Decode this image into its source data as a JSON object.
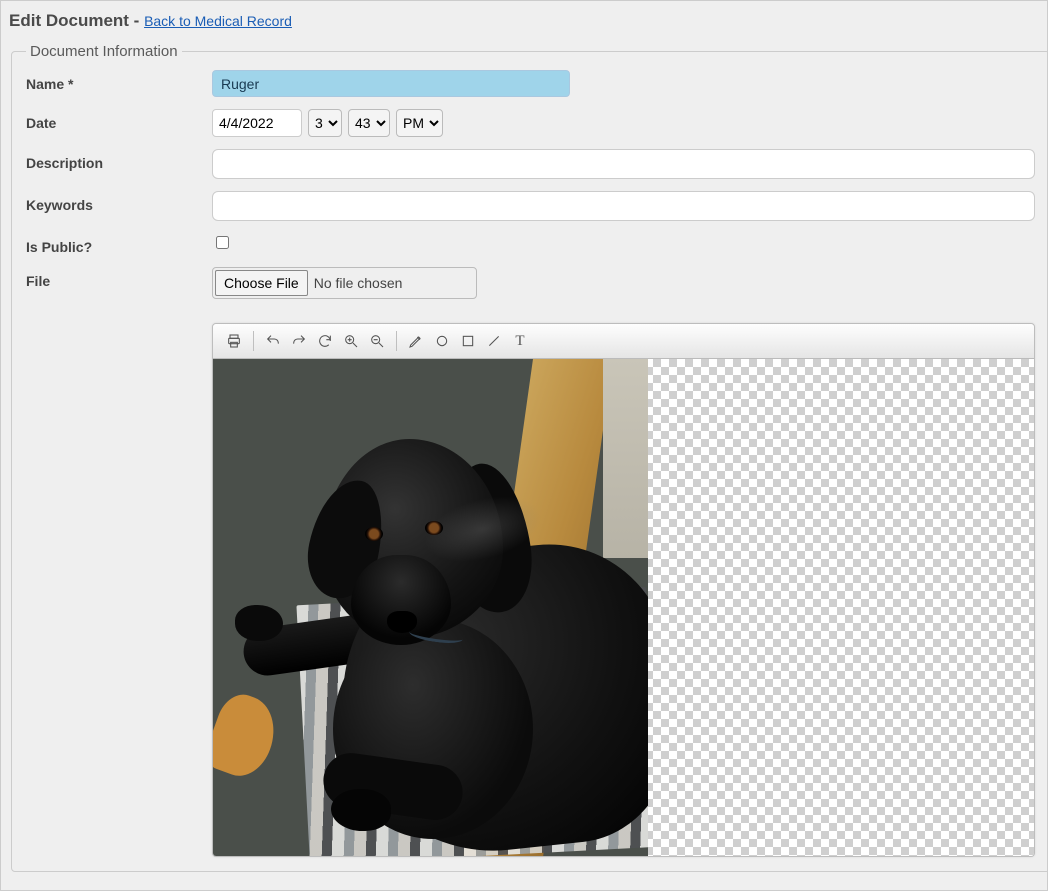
{
  "header": {
    "title_prefix": "Edit Document - ",
    "back_link": "Back to Medical Record"
  },
  "fieldset": {
    "legend": "Document Information"
  },
  "labels": {
    "name": "Name *",
    "date": "Date",
    "description": "Description",
    "keywords": "Keywords",
    "is_public": "Is Public?",
    "file": "File"
  },
  "form": {
    "name_value": "Ruger",
    "date_value": "4/4/2022",
    "hour_value": "3",
    "minute_value": "43",
    "ampm_value": "PM",
    "description_value": "",
    "keywords_value": "",
    "is_public_checked": false,
    "file_button": "Choose File",
    "file_status": "No file chosen"
  },
  "toolbar": {
    "print": "Print",
    "undo": "Undo",
    "redo": "Redo",
    "rotate": "Rotate",
    "zoom_in": "Zoom In",
    "zoom_out": "Zoom Out",
    "pencil": "Pencil",
    "circle": "Circle",
    "rect": "Rectangle",
    "line": "Line",
    "text": "Text"
  },
  "image": {
    "description": "Photo of a black Labrador dog (Ruger) lying on a striped rug over grey carpet next to wooden door trim."
  }
}
